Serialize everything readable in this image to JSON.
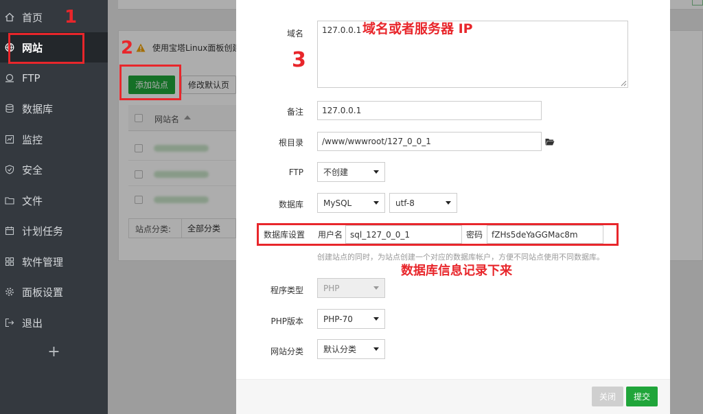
{
  "sidebar": {
    "items": [
      {
        "label": "首页",
        "icon": "home-icon"
      },
      {
        "label": "网站",
        "icon": "globe-icon",
        "active": true
      },
      {
        "label": "FTP",
        "icon": "ftp-icon"
      },
      {
        "label": "数据库",
        "icon": "database-icon"
      },
      {
        "label": "监控",
        "icon": "monitor-icon"
      },
      {
        "label": "安全",
        "icon": "shield-icon"
      },
      {
        "label": "文件",
        "icon": "folder-icon"
      },
      {
        "label": "计划任务",
        "icon": "calendar-icon"
      },
      {
        "label": "软件管理",
        "icon": "grid-icon"
      },
      {
        "label": "面板设置",
        "icon": "gear-icon"
      },
      {
        "label": "退出",
        "icon": "logout-icon"
      }
    ],
    "add_label": "+"
  },
  "background": {
    "warning_text": "使用宝塔Linux面板创建",
    "add_site_button": "添加站点",
    "default_page_button": "修改默认页",
    "column_site_name": "网站名",
    "category_label": "站点分类:",
    "category_value": "全部分类"
  },
  "modal": {
    "domain_label": "域名",
    "domain_value": "127.0.0.1",
    "remark_label": "备注",
    "remark_value": "127.0.0.1",
    "root_label": "根目录",
    "root_value": "/www/wwwroot/127_0_0_1",
    "ftp_label": "FTP",
    "ftp_value": "不创建",
    "db_label": "数据库",
    "db_type_value": "MySQL",
    "db_charset_value": "utf-8",
    "db_settings_label": "数据库设置",
    "db_username_label": "用户名",
    "db_username_value": "sql_127_0_0_1",
    "db_password_label": "密码",
    "db_password_value": "fZHs5deYaGGMac8m",
    "db_hint": "创建站点的同时，为站点创建一个对应的数据库帐户，方便不同站点使用不同数据库。",
    "program_type_label": "程序类型",
    "program_type_value": "PHP",
    "php_version_label": "PHP版本",
    "php_version_value": "PHP-70",
    "site_category_label": "网站分类",
    "site_category_value": "默认分类",
    "close_button": "关闭",
    "submit_button": "提交"
  },
  "annotations": {
    "step1": "1",
    "step2": "2",
    "step3": "3",
    "domain_note": "域名或者服务器 IP",
    "db_note": "数据库信息记录下来"
  },
  "colors": {
    "sidebar_bg": "#34393f",
    "brand_green": "#20a53a",
    "annotation_red": "#e8262b"
  }
}
